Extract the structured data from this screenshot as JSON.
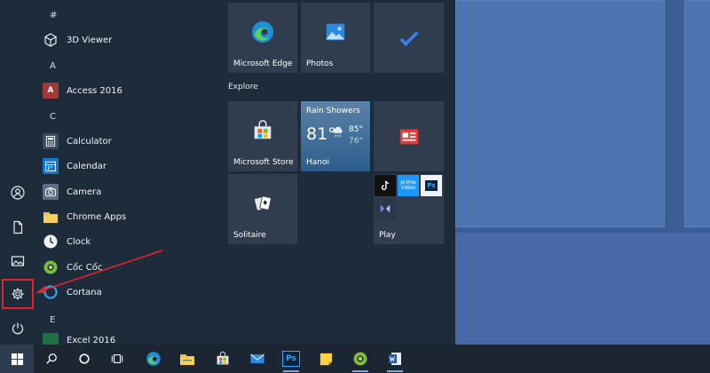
{
  "start_menu": {
    "sections": [
      {
        "letter": "#",
        "apps": [
          "3D Viewer"
        ]
      },
      {
        "letter": "A",
        "apps": [
          "Access 2016"
        ]
      },
      {
        "letter": "C",
        "apps": [
          "Calculator",
          "Calendar",
          "Camera",
          "Chrome Apps",
          "Clock",
          "Cốc Cốc",
          "Cortana"
        ]
      },
      {
        "letter": "E",
        "apps": [
          "Excel 2016"
        ]
      }
    ],
    "access_icon_letter": "A",
    "tiles": {
      "edge": "Microsoft Edge",
      "photos": "Photos",
      "explore_header": "Explore",
      "store": "Microsoft Store",
      "weather": {
        "condition": "Rain Showers",
        "temp": "81°",
        "high": "85°",
        "low": "76°",
        "city": "Hanoi"
      },
      "solitaire": "Solitaire",
      "play": "Play",
      "prime_video": "prime video",
      "photoshop": "Ps"
    }
  },
  "taskbar": {
    "photoshop": "Ps"
  },
  "colors": {
    "highlight": "#e0262c",
    "accent": "#0078d4"
  }
}
